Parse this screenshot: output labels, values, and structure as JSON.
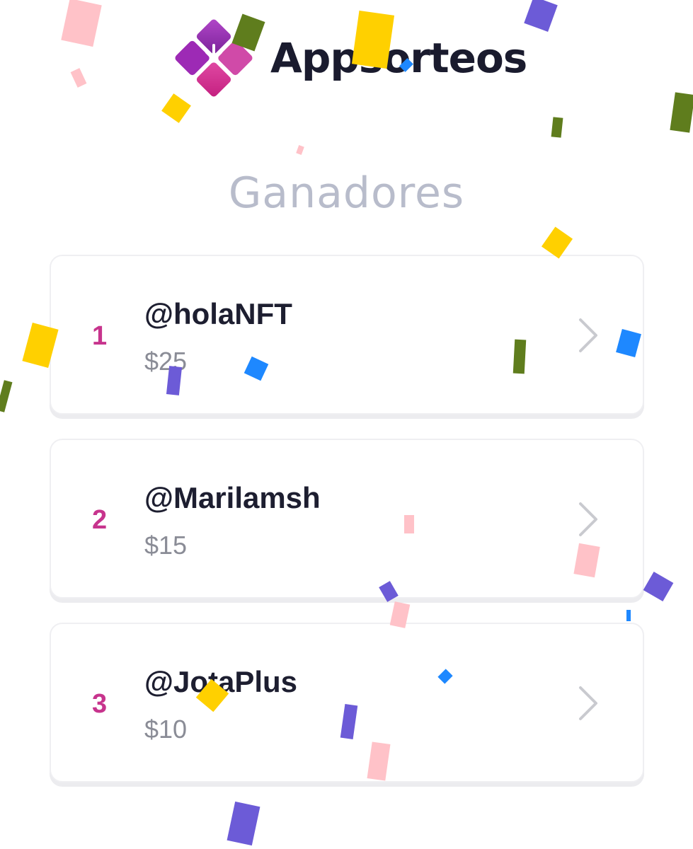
{
  "app": {
    "logo_text": "Appsorteos"
  },
  "page": {
    "title": "Ganadores"
  },
  "winners": [
    {
      "rank": "1",
      "handle": "@holaNFT",
      "prize": "$25"
    },
    {
      "rank": "2",
      "handle": "@Marilamsh",
      "prize": "$15"
    },
    {
      "rank": "3",
      "handle": "@JotaPlus",
      "prize": "$10"
    }
  ],
  "colors": {
    "brand_magenta": "#c7348d",
    "brand_purple": "#8e2bb0",
    "confetti_yellow": "#ffd000",
    "confetti_pink": "#ffc2c8",
    "confetti_purple": "#6c5bd7",
    "confetti_blue": "#1e88ff",
    "confetti_green": "#5f7d1d"
  },
  "icons": {
    "chevron": "chevron-right-icon",
    "logo": "appsorteos-logo-icon"
  }
}
